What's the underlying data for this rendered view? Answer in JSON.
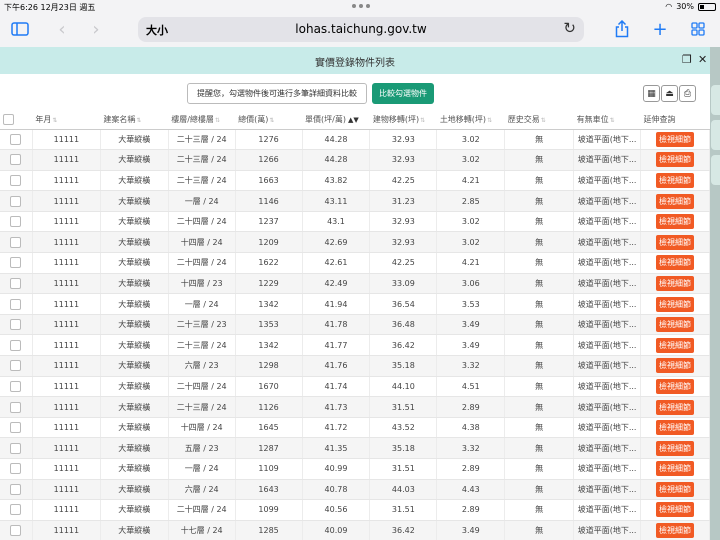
{
  "status": {
    "time_date": "下午6:26  12月23日 週五",
    "battery": "30%"
  },
  "browser": {
    "text_size": "大小",
    "url": "lohas.taichung.gov.tw"
  },
  "modal": {
    "title": "實價登錄物件列表",
    "note": "提醒您，勾選物件後可進行多筆詳細資料比較",
    "compare_button": "比較勾選物件"
  },
  "table": {
    "headers": [
      "年月",
      "建案名稱",
      "樓層/總樓層",
      "總價(萬)",
      "單價(坪/萬)",
      "建物移轉(坪)",
      "土地移轉(坪)",
      "歷史交易",
      "有無車位",
      "延伸查詢"
    ],
    "view_label": "檢視細節",
    "rows": [
      [
        "11111",
        "大華縱橫",
        "二十三層 / 24",
        "1276",
        "44.28",
        "32.93",
        "3.02",
        "無",
        "坡道平面(地下..."
      ],
      [
        "11111",
        "大華縱橫",
        "二十三層 / 24",
        "1266",
        "44.28",
        "32.93",
        "3.02",
        "無",
        "坡道平面(地下..."
      ],
      [
        "11111",
        "大華縱橫",
        "二十三層 / 24",
        "1663",
        "43.82",
        "42.25",
        "4.21",
        "無",
        "坡道平面(地下..."
      ],
      [
        "11111",
        "大華縱橫",
        "一層 / 24",
        "1146",
        "43.11",
        "31.23",
        "2.85",
        "無",
        "坡道平面(地下..."
      ],
      [
        "11111",
        "大華縱橫",
        "二十四層 / 24",
        "1237",
        "43.1",
        "32.93",
        "3.02",
        "無",
        "坡道平面(地下..."
      ],
      [
        "11111",
        "大華縱橫",
        "十四層 / 24",
        "1209",
        "42.69",
        "32.93",
        "3.02",
        "無",
        "坡道平面(地下..."
      ],
      [
        "11111",
        "大華縱橫",
        "二十四層 / 24",
        "1622",
        "42.61",
        "42.25",
        "4.21",
        "無",
        "坡道平面(地下..."
      ],
      [
        "11111",
        "大華縱橫",
        "十四層 / 23",
        "1229",
        "42.49",
        "33.09",
        "3.06",
        "無",
        "坡道平面(地下..."
      ],
      [
        "11111",
        "大華縱橫",
        "一層 / 24",
        "1342",
        "41.94",
        "36.54",
        "3.53",
        "無",
        "坡道平面(地下..."
      ],
      [
        "11111",
        "大華縱橫",
        "二十三層 / 23",
        "1353",
        "41.78",
        "36.48",
        "3.49",
        "無",
        "坡道平面(地下..."
      ],
      [
        "11111",
        "大華縱橫",
        "二十三層 / 24",
        "1342",
        "41.77",
        "36.42",
        "3.49",
        "無",
        "坡道平面(地下..."
      ],
      [
        "11111",
        "大華縱橫",
        "六層 / 23",
        "1298",
        "41.76",
        "35.18",
        "3.32",
        "無",
        "坡道平面(地下..."
      ],
      [
        "11111",
        "大華縱橫",
        "二十四層 / 24",
        "1670",
        "41.74",
        "44.10",
        "4.51",
        "無",
        "坡道平面(地下..."
      ],
      [
        "11111",
        "大華縱橫",
        "二十三層 / 24",
        "1126",
        "41.73",
        "31.51",
        "2.89",
        "無",
        "坡道平面(地下..."
      ],
      [
        "11111",
        "大華縱橫",
        "十四層 / 24",
        "1645",
        "41.72",
        "43.52",
        "4.38",
        "無",
        "坡道平面(地下..."
      ],
      [
        "11111",
        "大華縱橫",
        "五層 / 23",
        "1287",
        "41.35",
        "35.18",
        "3.32",
        "無",
        "坡道平面(地下..."
      ],
      [
        "11111",
        "大華縱橫",
        "一層 / 24",
        "1109",
        "40.99",
        "31.51",
        "2.89",
        "無",
        "坡道平面(地下..."
      ],
      [
        "11111",
        "大華縱橫",
        "六層 / 24",
        "1643",
        "40.78",
        "44.03",
        "4.43",
        "無",
        "坡道平面(地下..."
      ],
      [
        "11111",
        "大華縱橫",
        "二十四層 / 24",
        "1099",
        "40.56",
        "31.51",
        "2.89",
        "無",
        "坡道平面(地下..."
      ],
      [
        "11111",
        "大華縱橫",
        "十七層 / 24",
        "1285",
        "40.09",
        "36.42",
        "3.49",
        "無",
        "坡道平面(地下..."
      ]
    ]
  }
}
